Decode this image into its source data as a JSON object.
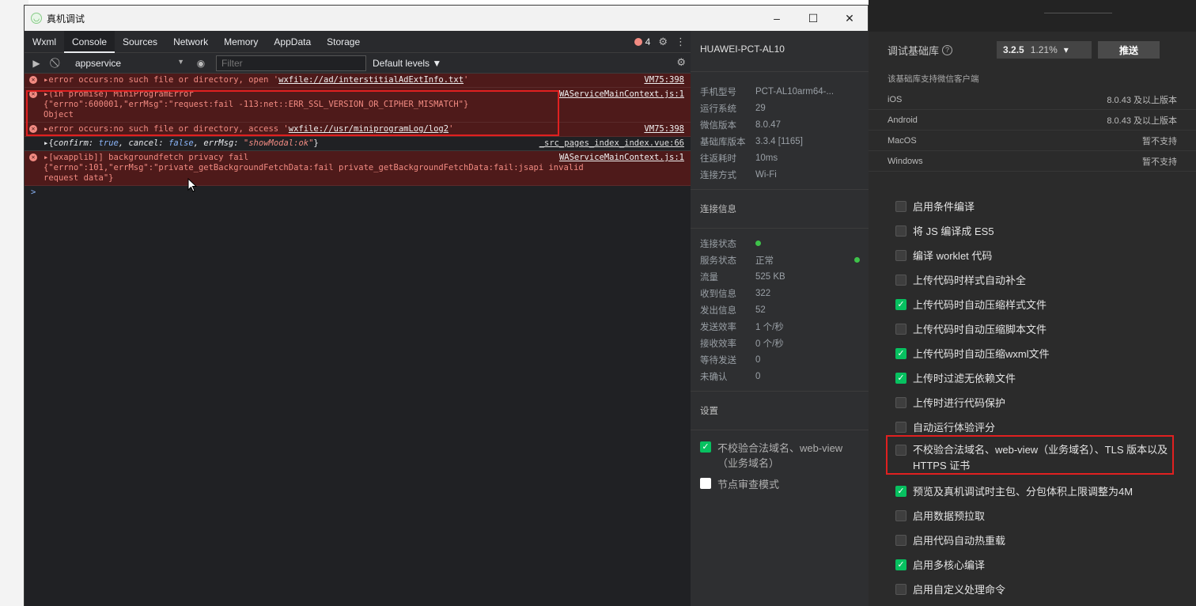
{
  "window": {
    "title": "真机调试",
    "min": "–",
    "max": "☐",
    "close": "✕"
  },
  "devtools": {
    "tabs": [
      "Wxml",
      "Console",
      "Sources",
      "Network",
      "Memory",
      "AppData",
      "Storage"
    ],
    "error_count": "4",
    "toolbar": {
      "context": "appservice",
      "context_arrow": "▼",
      "filter_placeholder": "Filter",
      "levels": "Default levels ▼"
    },
    "messages": [
      {
        "type": "error",
        "text": "▸error occurs:no such file or directory, open '",
        "link": "wxfile://ad/interstitialAdExtInfo.txt",
        "tail": "'",
        "source": "VM75:398"
      },
      {
        "type": "error",
        "text": "▸(in promise) MiniProgramError",
        "line2": "{\"errno\":600001,\"errMsg\":\"request:fail -113:net::ERR_SSL_VERSION_OR_CIPHER_MISMATCH\"}",
        "line3": "Object",
        "source": "WAServiceMainContext.js:1"
      },
      {
        "type": "error",
        "text": "▸error occurs:no such file or directory, access '",
        "link": "wxfile://usr/miniprogramLog/log2",
        "tail": "'",
        "source": "VM75:398"
      },
      {
        "type": "log",
        "source": "_src_pages_index_index.vue:66"
      },
      {
        "type": "error",
        "text": "▸[wxapplib]] backgroundfetch privacy fail",
        "line2": "{\"errno\":101,\"errMsg\":\"private_getBackgroundFetchData:fail private_getBackgroundFetchData:fail:jsapi invalid",
        "line3": "request data\"}",
        "source": "WAServiceMainContext.js:1"
      }
    ],
    "log_parts": {
      "open": "▸{",
      "k1": "confirm: ",
      "v1": "true",
      "k2": ", cancel: ",
      "v2": "false",
      "k3": ", errMsg: ",
      "v3": "\"showModal:ok\"",
      "close": "}"
    },
    "prompt": ">"
  },
  "info": {
    "device": "HUAWEI-PCT-AL10",
    "rows": [
      {
        "label": "手机型号",
        "value": "PCT-AL10arm64-..."
      },
      {
        "label": "运行系统",
        "value": "29"
      },
      {
        "label": "微信版本",
        "value": "8.0.47"
      },
      {
        "label": "基础库版本",
        "value": "3.3.4 [1165]"
      },
      {
        "label": "往返耗时",
        "value": "10ms"
      },
      {
        "label": "连接方式",
        "value": "Wi-Fi"
      }
    ],
    "conn_title": "连接信息",
    "conn_rows": [
      {
        "label": "连接状态",
        "value": ""
      },
      {
        "label": "服务状态",
        "value": "正常"
      },
      {
        "label": "流量",
        "value": "525 KB"
      },
      {
        "label": "收到信息",
        "value": "322"
      },
      {
        "label": "发出信息",
        "value": "52"
      },
      {
        "label": "发送效率",
        "value": "1 个/秒"
      },
      {
        "label": "接收效率",
        "value": "0 个/秒"
      },
      {
        "label": "等待发送",
        "value": "0"
      },
      {
        "label": "未确认",
        "value": "0"
      }
    ],
    "settings_title": "设置",
    "checks": [
      {
        "label": "不校验合法域名、web-view（业务域名）",
        "checked": true
      },
      {
        "label": "节点审查模式",
        "checked": false
      }
    ]
  },
  "settings": {
    "lib_label": "调试基础库",
    "lib_version": "3.2.5",
    "lib_pct": "1.21%",
    "lib_arrow": "▾",
    "push": "推送",
    "support_title": "该基础库支持微信客户端",
    "support": [
      {
        "os": "iOS",
        "ver": "8.0.43 及以上版本"
      },
      {
        "os": "Android",
        "ver": "8.0.43 及以上版本"
      },
      {
        "os": "MacOS",
        "ver": "暂不支持"
      },
      {
        "os": "Windows",
        "ver": "暂不支持"
      }
    ],
    "options": [
      {
        "label": "启用条件编译",
        "checked": false
      },
      {
        "label": "将 JS 编译成 ES5",
        "checked": false
      },
      {
        "label": "编译 worklet 代码",
        "checked": false
      },
      {
        "label": "上传代码时样式自动补全",
        "checked": false
      },
      {
        "label": "上传代码时自动压缩样式文件",
        "checked": true
      },
      {
        "label": "上传代码时自动压缩脚本文件",
        "checked": false
      },
      {
        "label": "上传代码时自动压缩wxml文件",
        "checked": true
      },
      {
        "label": "上传时过滤无依赖文件",
        "checked": true
      },
      {
        "label": "上传时进行代码保护",
        "checked": false
      },
      {
        "label": "自动运行体验评分",
        "checked": false
      },
      {
        "label": "不校验合法域名、web-view（业务域名）、TLS 版本以及 HTTPS 证书",
        "checked": false
      },
      {
        "label": "预览及真机调试时主包、分包体积上限调整为4M",
        "checked": true
      },
      {
        "label": "启用数据预拉取",
        "checked": false
      },
      {
        "label": "启用代码自动热重载",
        "checked": false
      },
      {
        "label": "启用多核心编译",
        "checked": true
      },
      {
        "label": "启用自定义处理命令",
        "checked": false
      }
    ]
  },
  "colors": {
    "error_bg": "#4e1a1a",
    "error_text": "#f28b82",
    "accent_green": "#07c160",
    "highlight_red": "#e02020"
  }
}
